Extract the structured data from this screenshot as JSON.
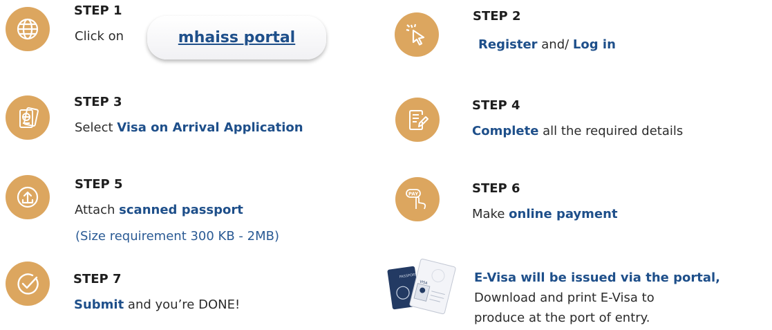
{
  "steps": {
    "s1": {
      "title": "STEP 1",
      "prefix": "Click on",
      "button": "mhaiss portal"
    },
    "s2": {
      "title": "STEP 2",
      "hl1": "Register",
      "mid": " and/ ",
      "hl2": "Log in"
    },
    "s3": {
      "title": "STEP 3",
      "prefix": "Select ",
      "hl": "Visa on Arrival Application"
    },
    "s4": {
      "title": "STEP 4",
      "hl": "Complete",
      "suffix": " all the required details"
    },
    "s5": {
      "title": "STEP 5",
      "prefix": "Attach ",
      "hl": "scanned passport",
      "note": "(Size requirement 300 KB - 2MB)"
    },
    "s6": {
      "title": "STEP 6",
      "prefix": "Make ",
      "hl": "online payment"
    },
    "s7": {
      "title": "STEP 7",
      "hl": "Submit",
      "suffix": " and you’re DONE!"
    }
  },
  "final": {
    "title": "E-Visa will be issued via the portal,",
    "line1": "Download and print E-Visa to",
    "line2": "produce at the port of entry."
  },
  "art": {
    "passport_label": "PASSPORT",
    "visa_label": "VISA"
  },
  "colors": {
    "icon_bg": "#dca65f",
    "highlight": "#1e4f8a",
    "passport": "#233a63"
  },
  "icons": [
    "globe-icon",
    "cursor-click-icon",
    "passport-icon",
    "form-edit-icon",
    "upload-icon",
    "pay-tap-icon",
    "check-circle-icon"
  ]
}
